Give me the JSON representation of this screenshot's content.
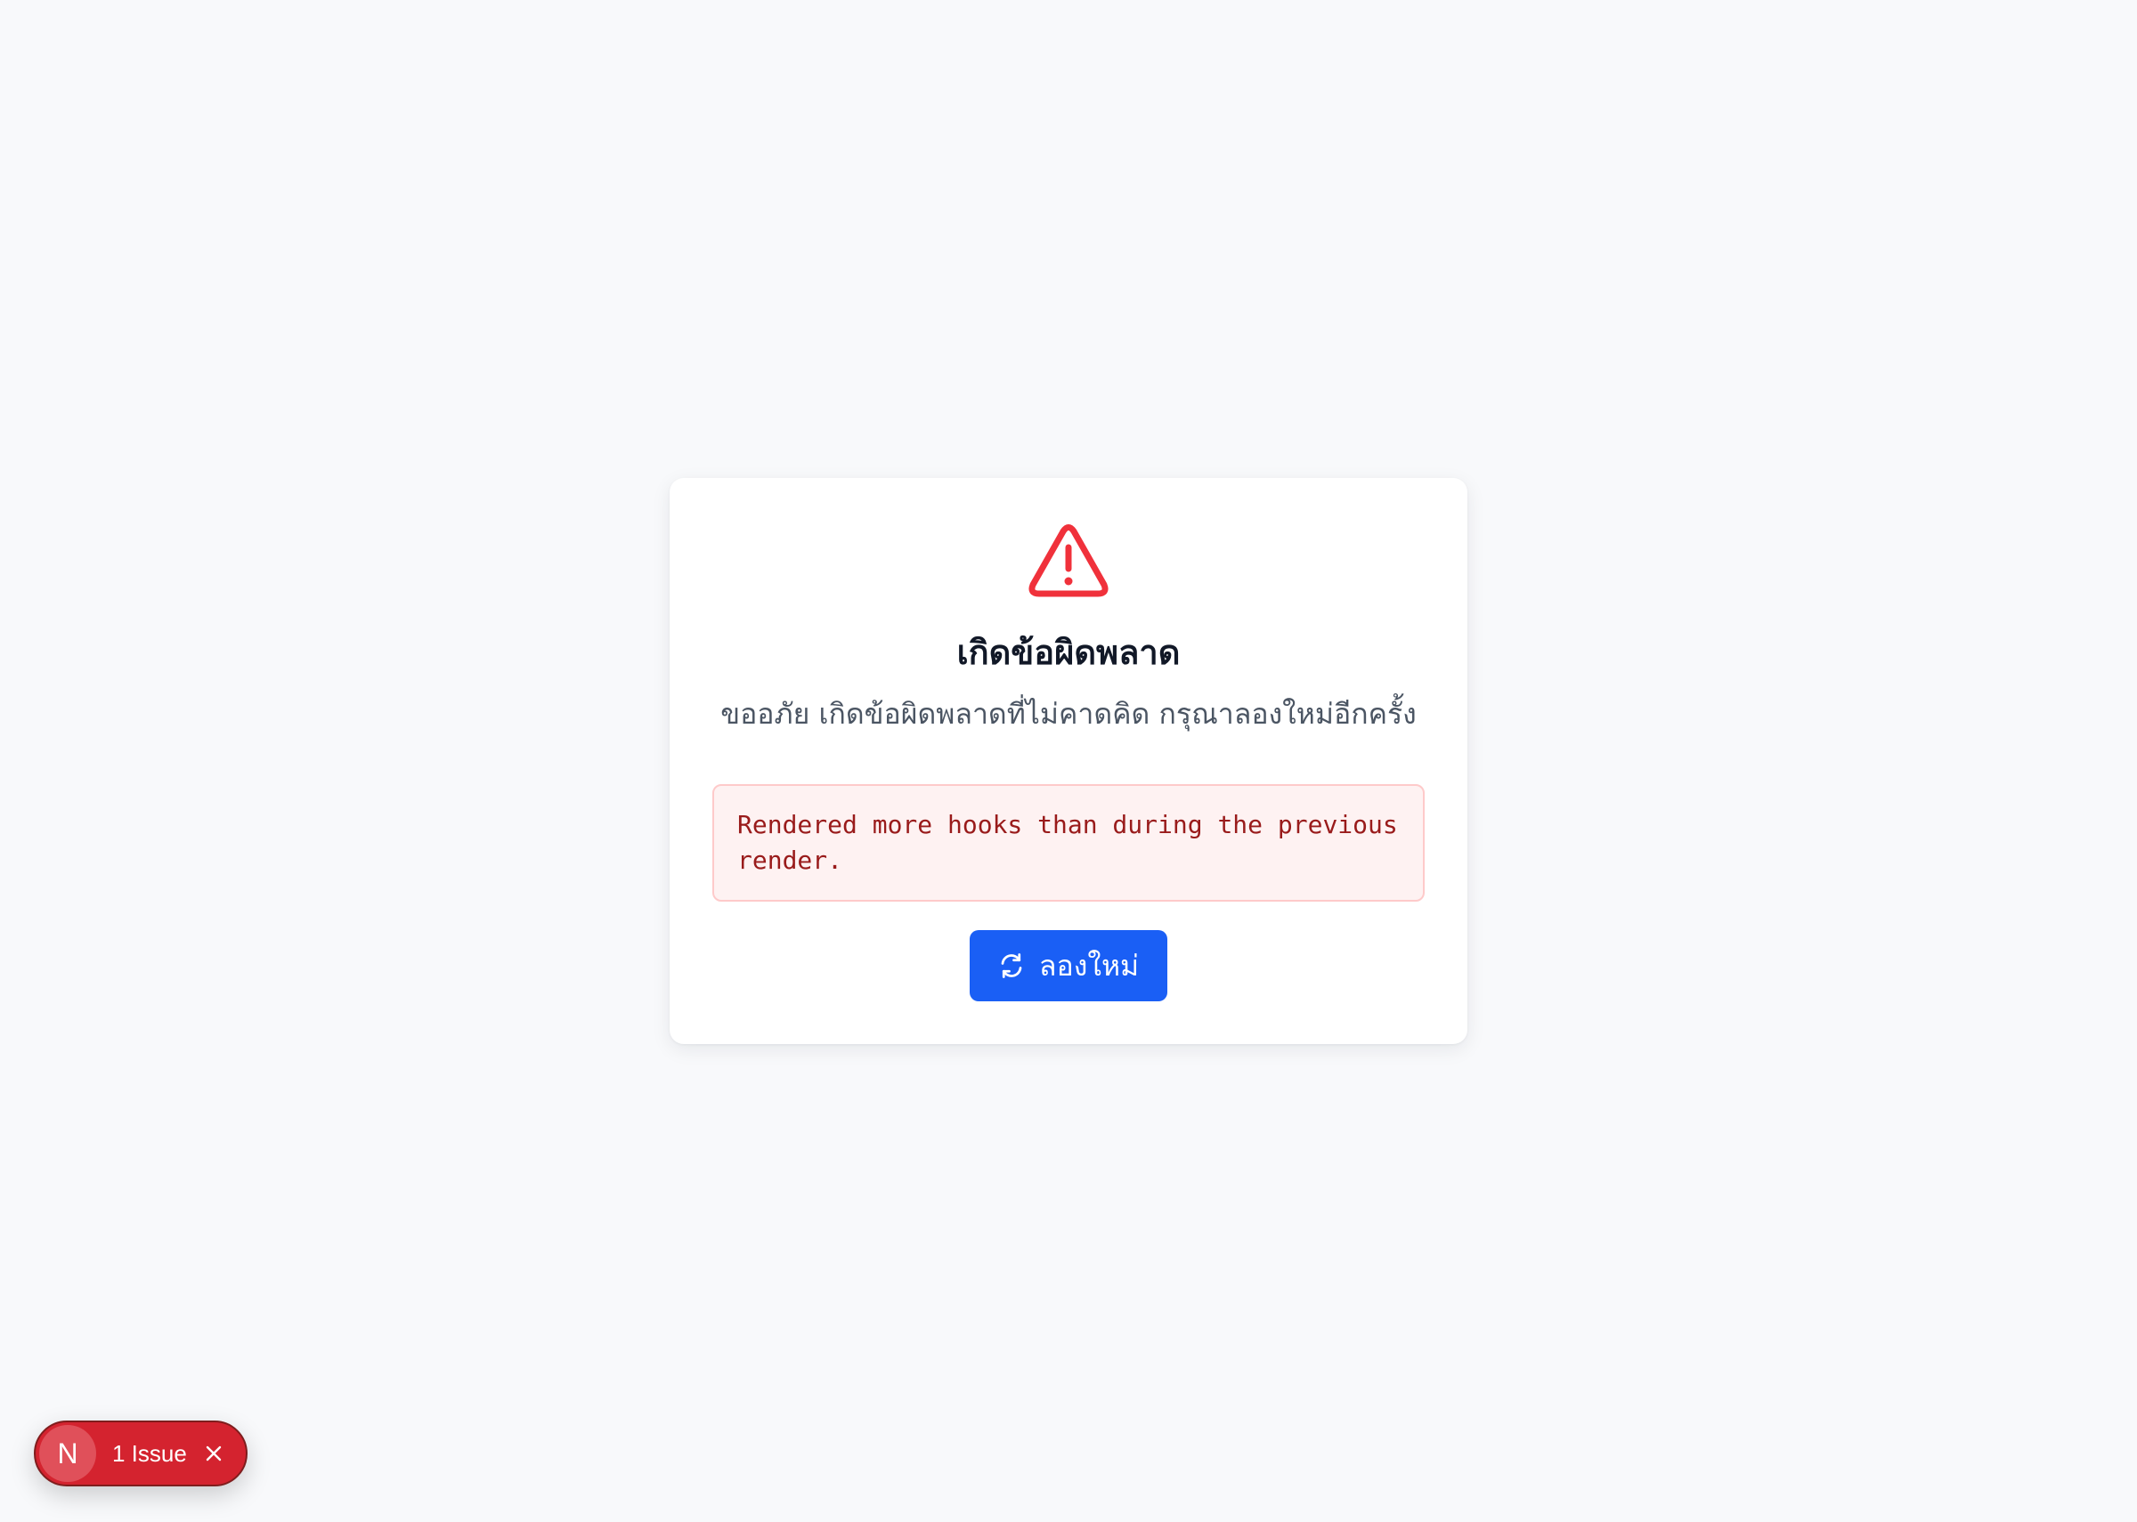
{
  "error_card": {
    "icon": "warning-triangle-icon",
    "title": "เกิดข้อผิดพลาด",
    "subtitle": "ขออภัย เกิดข้อผิดพลาดที่ไม่คาดคิด กรุณาลองใหม่อีกครั้ง",
    "error_message": "Rendered more hooks than during the previous render.",
    "retry_button": {
      "icon": "refresh-icon",
      "label": "ลองใหม่"
    }
  },
  "dev_overlay": {
    "badge_letter": "N",
    "issue_label": "1 Issue",
    "close_icon": "close-icon"
  },
  "colors": {
    "background": "#f8f9fb",
    "warning": "#f0313b",
    "primary_button": "#1a5ff5",
    "error_text": "#991b1b",
    "error_box_bg": "#fef2f2",
    "issue_pill": "#d4232f"
  }
}
